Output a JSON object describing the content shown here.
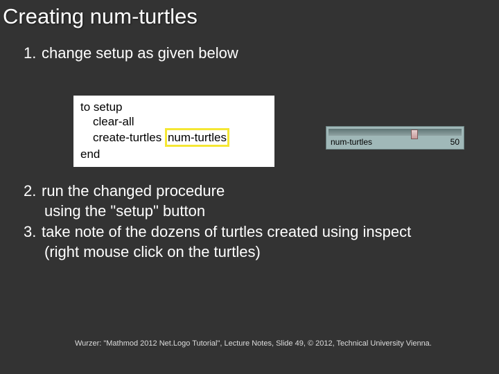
{
  "title": "Creating num-turtles",
  "step1": {
    "num": "1.",
    "text": "change setup as given below"
  },
  "code": {
    "l1": "to setup",
    "l2": "clear-all",
    "l3a": "create-turtles ",
    "l3b": "num-turtles",
    "l4": "end"
  },
  "slider": {
    "label": "num-turtles",
    "value": "50"
  },
  "step2": {
    "num": "2.",
    "line1": "run the changed procedure",
    "line2": "using the \"setup\" button"
  },
  "step3": {
    "num": "3.",
    "line1": "take note of the dozens of turtles created using inspect",
    "line2": "(right mouse click on the turtles)"
  },
  "footer": "Wurzer: \"Mathmod 2012 Net.Logo Tutorial\", Lecture Notes, Slide 49, © 2012, Technical University Vienna."
}
